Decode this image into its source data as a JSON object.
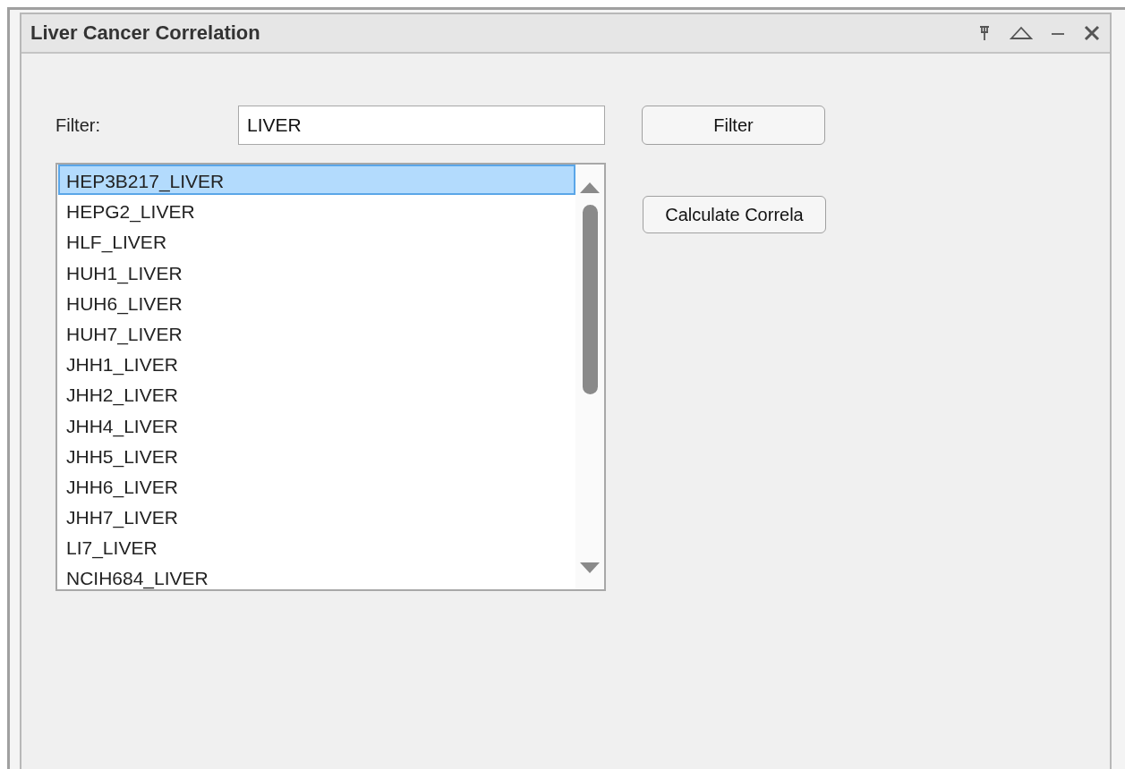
{
  "window": {
    "title": "Liver Cancer Correlation"
  },
  "filter": {
    "label": "Filter:",
    "value": "LIVER"
  },
  "buttons": {
    "filter": "Filter",
    "calculate": "Calculate Correla"
  },
  "list": {
    "items": [
      {
        "label": "HEP3B217_LIVER",
        "selected": true
      },
      {
        "label": "HEPG2_LIVER",
        "selected": false
      },
      {
        "label": "HLF_LIVER",
        "selected": false
      },
      {
        "label": "HUH1_LIVER",
        "selected": false
      },
      {
        "label": "HUH6_LIVER",
        "selected": false
      },
      {
        "label": "HUH7_LIVER",
        "selected": false
      },
      {
        "label": "JHH1_LIVER",
        "selected": false
      },
      {
        "label": "JHH2_LIVER",
        "selected": false
      },
      {
        "label": "JHH4_LIVER",
        "selected": false
      },
      {
        "label": "JHH5_LIVER",
        "selected": false
      },
      {
        "label": "JHH6_LIVER",
        "selected": false
      },
      {
        "label": "JHH7_LIVER",
        "selected": false
      },
      {
        "label": "LI7_LIVER",
        "selected": false
      },
      {
        "label": "NCIH684_LIVER",
        "selected": false
      }
    ]
  }
}
